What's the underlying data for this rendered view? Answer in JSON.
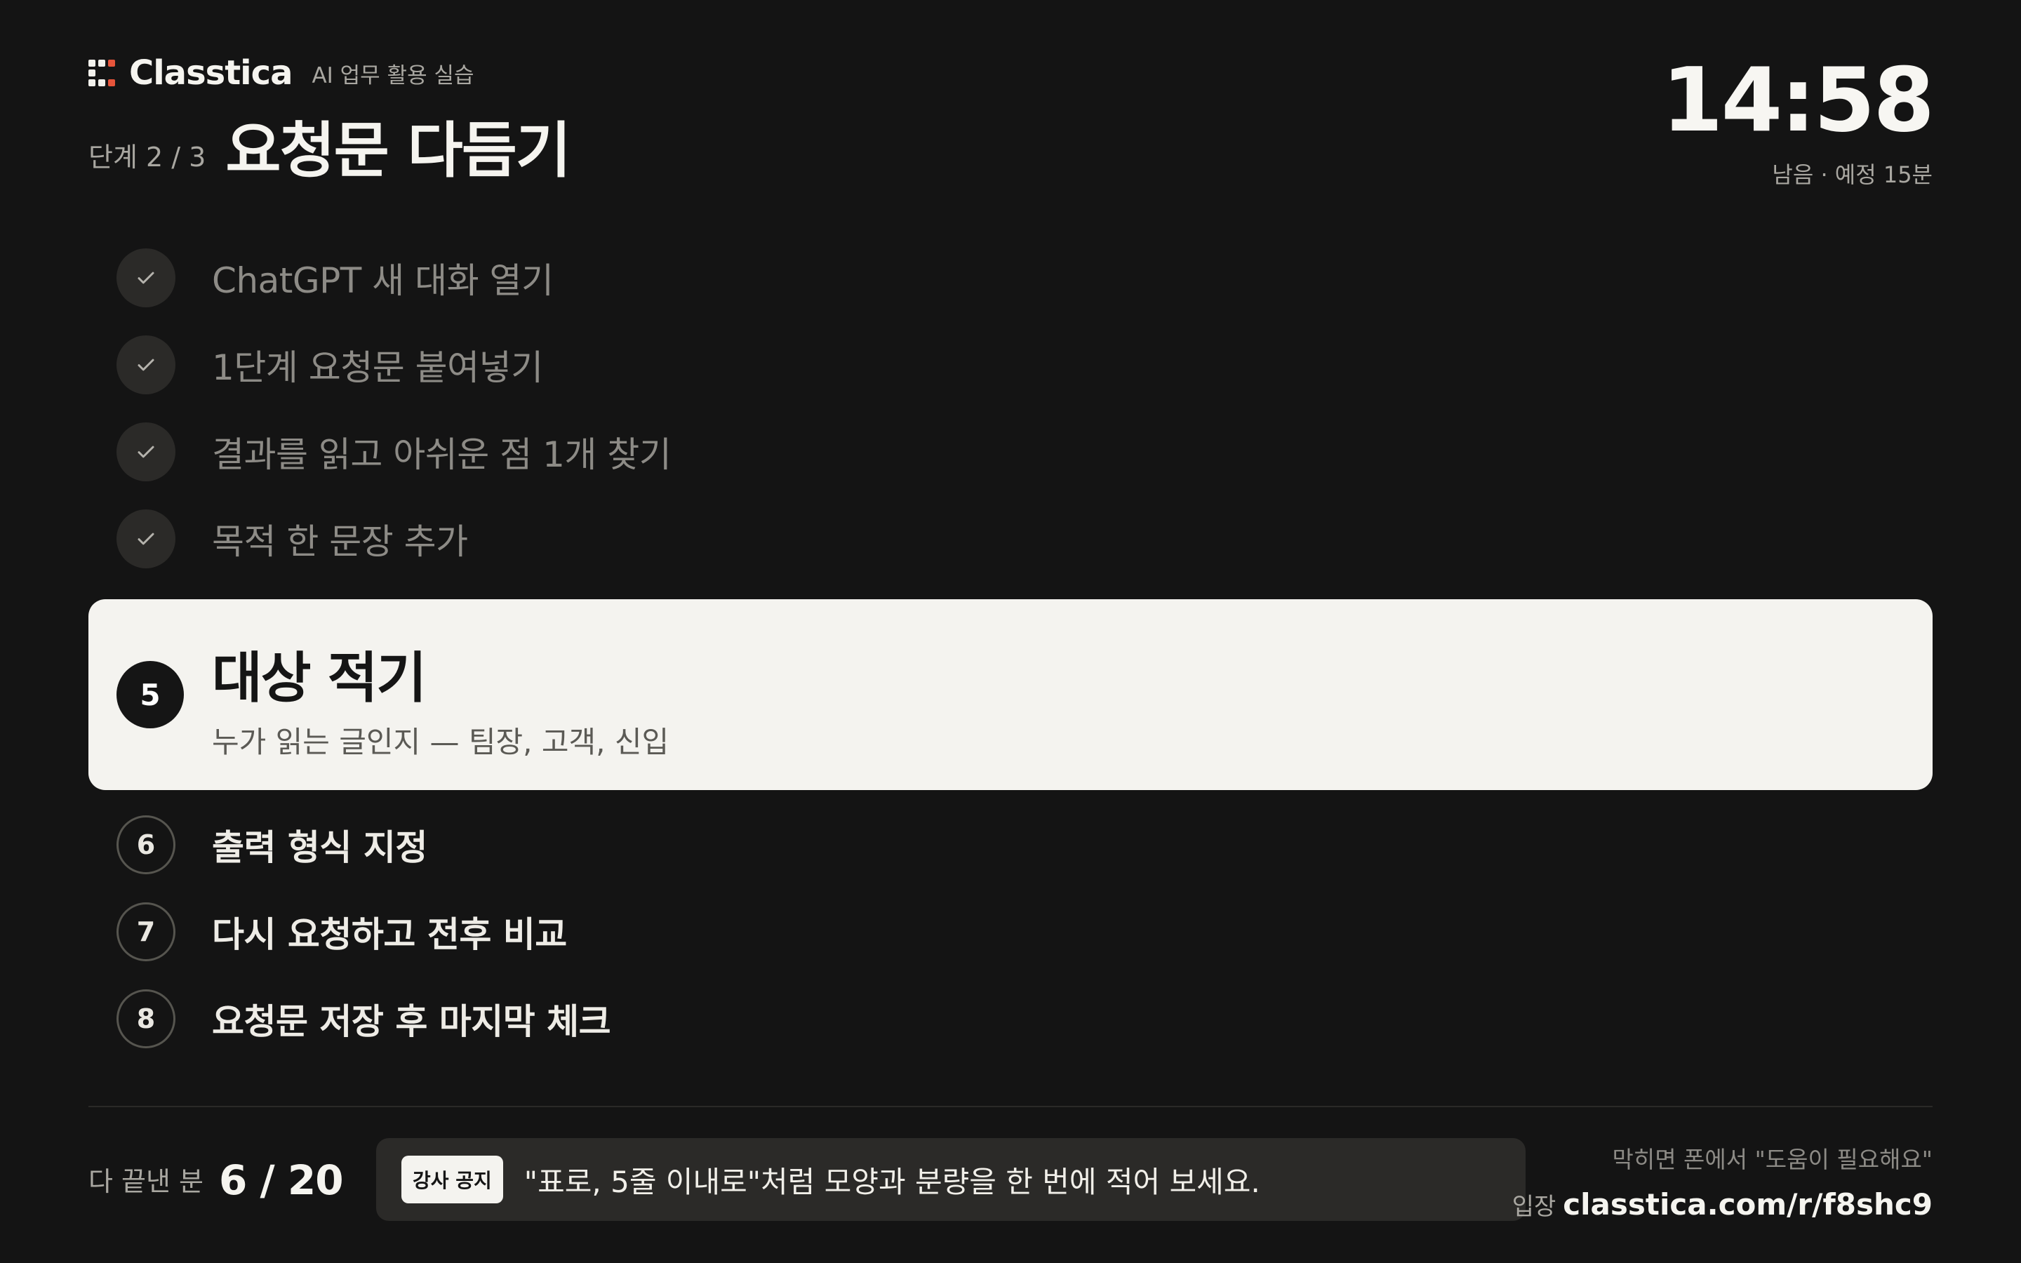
{
  "header": {
    "brand_name": "Classtica",
    "brand_subtitle": "AI 업무 활용 실습",
    "stage_label": "단계 2 / 3",
    "stage_title": "요청문 다듬기"
  },
  "timer": {
    "value": "14:58",
    "caption": "남음 · 예정 15분"
  },
  "steps": {
    "done": [
      {
        "label": "ChatGPT 새 대화 열기"
      },
      {
        "label": "1단계 요청문 붙여넣기"
      },
      {
        "label": "결과를 읽고 아쉬운 점 1개 찾기"
      },
      {
        "label": "목적 한 문장 추가"
      }
    ],
    "current": {
      "number": "5",
      "title": "대상 적기",
      "description": "누가 읽는 글인지 — 팀장, 고객, 신입"
    },
    "todo": [
      {
        "number": "6",
        "label": "출력 형식 지정"
      },
      {
        "number": "7",
        "label": "다시 요청하고 전후 비교"
      },
      {
        "number": "8",
        "label": "요청문 저장 후 마지막 체크"
      }
    ]
  },
  "footer": {
    "progress_label": "다 끝낸 분",
    "progress_value": "6 / 20",
    "notice_badge": "강사 공지",
    "notice_text": "\"표로, 5줄 이내로\"처럼 모양과 분량을 한 번에 적어 보세요.",
    "help_line": "막히면 폰에서 \"도움이 필요해요\"",
    "entry_label": "입장",
    "entry_url": "classtica.com/r/f8shc9"
  },
  "colors": {
    "background": "#141414",
    "logo_accent": "#e7553b",
    "current_card": "#f4f3ef",
    "muted_text": "#8d8b86"
  },
  "icons": [
    "classtica-logo-icon",
    "check-icon"
  ]
}
